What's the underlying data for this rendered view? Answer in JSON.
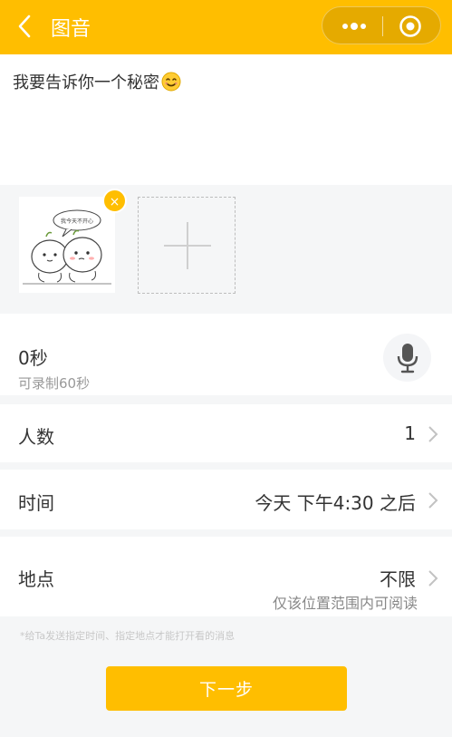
{
  "header": {
    "title": "图音",
    "back_icon": "chevron-left-icon",
    "more_icon": "more-dots-icon",
    "close_icon": "target-icon",
    "accent_color": "#FFBE00"
  },
  "message": {
    "text": "我要告诉你一个秘密",
    "emoji_icon": "smile-emoji-icon"
  },
  "photos": {
    "thumbnail_caption": "我今天不开心",
    "remove_label": "×",
    "add_icon": "plus-icon"
  },
  "voice": {
    "seconds": "0秒",
    "hint": "可录制60秒",
    "mic_icon": "microphone-icon"
  },
  "people": {
    "label": "人数",
    "value": "1"
  },
  "time": {
    "label": "时间",
    "value": "今天 下午4:30 之后"
  },
  "place": {
    "label": "地点",
    "value": "不限",
    "sub": "仅该位置范围内可阅读"
  },
  "footnote": "*给Ta发送指定时间、指定地点才能打开看的消息",
  "next_button": "下一步"
}
